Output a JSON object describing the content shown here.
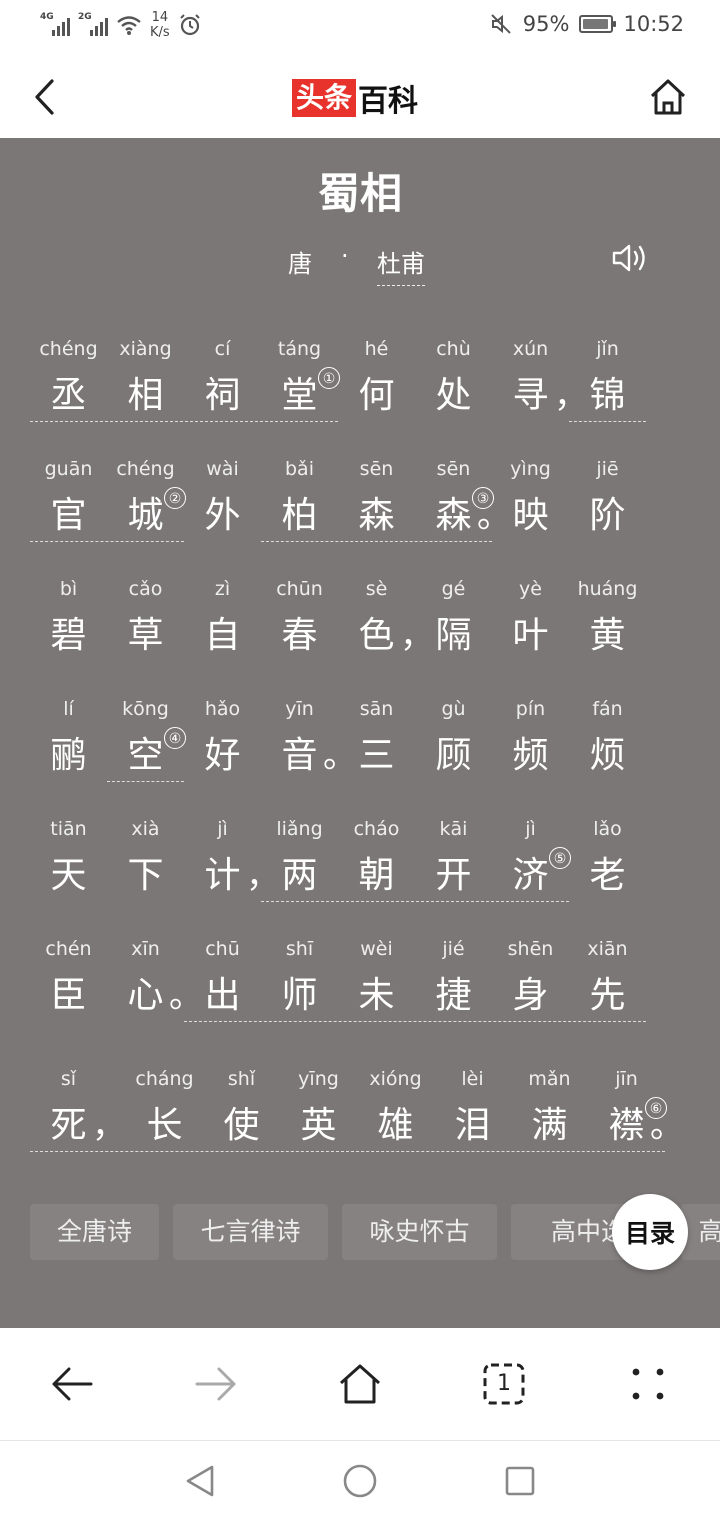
{
  "status_bar": {
    "signal1_label": "4G",
    "signal2_label": "2G",
    "speed_value": "14",
    "speed_unit": "K/s",
    "battery": "95%",
    "battery_level": 0.95,
    "time": "10:52"
  },
  "header": {
    "logo_red": "头条",
    "logo_black": "百科"
  },
  "poem": {
    "title": "蜀相",
    "dynasty": "唐",
    "separator": "·",
    "author": "杜甫",
    "lines": [
      [
        {
          "py": "chéng",
          "hz": "丞"
        },
        {
          "py": "xiàng",
          "hz": "相"
        },
        {
          "py": "cí",
          "hz": "祠"
        },
        {
          "py": "táng",
          "hz": "堂"
        },
        {
          "py": "hé",
          "hz": "何"
        },
        {
          "py": "chù",
          "hz": "处"
        },
        {
          "py": "xún",
          "hz": "寻"
        },
        {
          "py": "jǐn",
          "hz": "锦"
        }
      ],
      [
        {
          "py": "guān",
          "hz": "官"
        },
        {
          "py": "chéng",
          "hz": "城"
        },
        {
          "py": "wài",
          "hz": "外"
        },
        {
          "py": "bǎi",
          "hz": "柏"
        },
        {
          "py": "sēn",
          "hz": "森"
        },
        {
          "py": "sēn",
          "hz": "森"
        },
        {
          "py": "yìng",
          "hz": "映"
        },
        {
          "py": "jiē",
          "hz": "阶"
        }
      ],
      [
        {
          "py": "bì",
          "hz": "碧"
        },
        {
          "py": "cǎo",
          "hz": "草"
        },
        {
          "py": "zì",
          "hz": "自"
        },
        {
          "py": "chūn",
          "hz": "春"
        },
        {
          "py": "sè",
          "hz": "色"
        },
        {
          "py": "gé",
          "hz": "隔"
        },
        {
          "py": "yè",
          "hz": "叶"
        },
        {
          "py": "huáng",
          "hz": "黄"
        }
      ],
      [
        {
          "py": "lí",
          "hz": "鹂"
        },
        {
          "py": "kōng",
          "hz": "空"
        },
        {
          "py": "hǎo",
          "hz": "好"
        },
        {
          "py": "yīn",
          "hz": "音"
        },
        {
          "py": "sān",
          "hz": "三"
        },
        {
          "py": "gù",
          "hz": "顾"
        },
        {
          "py": "pín",
          "hz": "频"
        },
        {
          "py": "fán",
          "hz": "烦"
        }
      ],
      [
        {
          "py": "tiān",
          "hz": "天"
        },
        {
          "py": "xià",
          "hz": "下"
        },
        {
          "py": "jì",
          "hz": "计"
        },
        {
          "py": "liǎng",
          "hz": "两"
        },
        {
          "py": "cháo",
          "hz": "朝"
        },
        {
          "py": "kāi",
          "hz": "开"
        },
        {
          "py": "jì",
          "hz": "济"
        },
        {
          "py": "lǎo",
          "hz": "老"
        }
      ],
      [
        {
          "py": "chén",
          "hz": "臣"
        },
        {
          "py": "xīn",
          "hz": "心"
        },
        {
          "py": "chū",
          "hz": "出"
        },
        {
          "py": "shī",
          "hz": "师"
        },
        {
          "py": "wèi",
          "hz": "未"
        },
        {
          "py": "jié",
          "hz": "捷"
        },
        {
          "py": "shēn",
          "hz": "身"
        },
        {
          "py": "xiān",
          "hz": "先"
        }
      ],
      [
        {
          "py": "sǐ",
          "hz": "死"
        },
        {
          "py": "cháng",
          "hz": "长"
        },
        {
          "py": "shǐ",
          "hz": "使"
        },
        {
          "py": "yīng",
          "hz": "英"
        },
        {
          "py": "xióng",
          "hz": "雄"
        },
        {
          "py": "lèi",
          "hz": "泪"
        },
        {
          "py": "mǎn",
          "hz": "满"
        },
        {
          "py": "jīn",
          "hz": "襟"
        }
      ]
    ],
    "notes": [
      "①",
      "②",
      "③",
      "④",
      "⑤",
      "⑥"
    ],
    "punct": {
      "comma": "，",
      "period": "。"
    }
  },
  "tags": [
    "全唐诗",
    "七言律诗",
    "咏史怀古",
    "高中选",
    "高"
  ],
  "toc_label": "目录",
  "icons": {
    "back": "chevron-left-icon",
    "home": "home-icon",
    "speaker": "speaker-icon",
    "browser_back": "arrow-left-icon",
    "browser_forward": "arrow-right-icon",
    "browser_home": "home-icon",
    "tabs": "tabs-icon",
    "menu": "menu-dots-icon",
    "nav_back": "triangle-back-icon",
    "nav_home": "circle-home-icon",
    "nav_recent": "square-recent-icon"
  },
  "browser_tabs_count": "1"
}
